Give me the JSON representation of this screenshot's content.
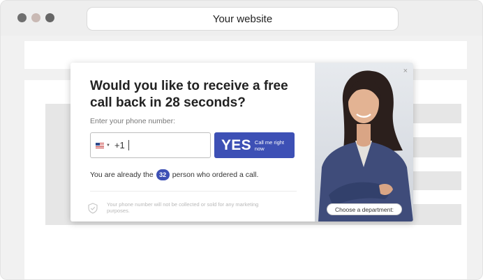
{
  "browser": {
    "address": "Your website"
  },
  "popup": {
    "title": "Would you like to receive a free call back in 28 seconds?",
    "phone_label": "Enter your phone number:",
    "country_code": "+1",
    "flag_icon": "us-flag-icon",
    "yes_label": "YES",
    "yes_sub": "Call me right now",
    "counter_prefix": "You are already the",
    "counter_value": "32",
    "counter_suffix": "person who ordered a call.",
    "disclaimer": "Your phone number will not be collected or sold for any marketing purposes.",
    "department_label": "Choose a department:",
    "close_label": "×",
    "accent_color": "#3d50b5"
  }
}
